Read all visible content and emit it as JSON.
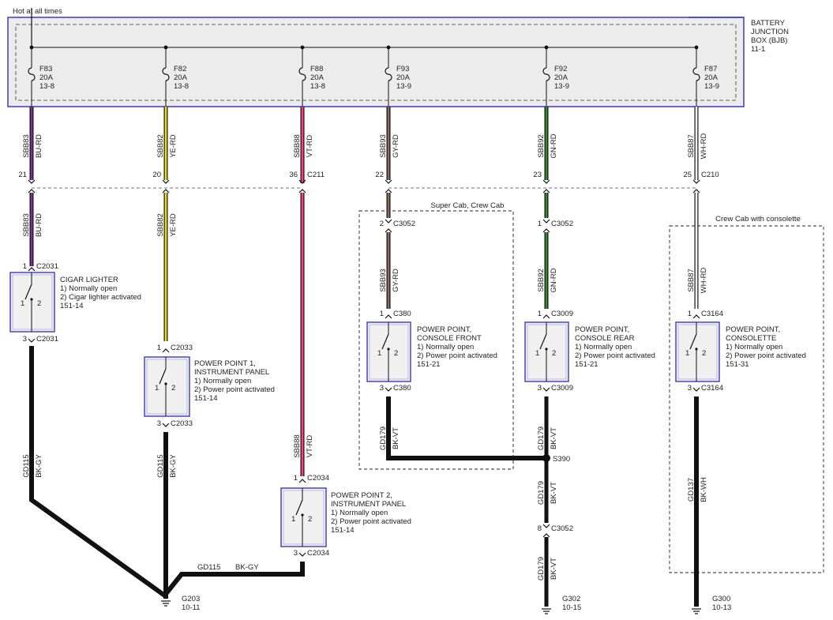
{
  "hot_label": "Hot at all times",
  "bjb": {
    "line1": "BATTERY",
    "line2": "JUNCTION",
    "line3": "BOX (BJB)",
    "ref": "11-1"
  },
  "colors": {
    "purple": "#7b3294",
    "yellow": "#f0e000",
    "pink": "#ff3d7f",
    "gray_brown": "#8c6a5c",
    "green": "#2e8b2e",
    "white": "#ffffff",
    "black": "#111111",
    "box_border": "#3a3ac8",
    "box_fill": "#f0f0f0",
    "bjb_fill": "#ececec"
  },
  "fuses": [
    {
      "name": "F83",
      "amps": "20A",
      "ref": "13-8"
    },
    {
      "name": "F82",
      "amps": "20A",
      "ref": "13-8"
    },
    {
      "name": "F88",
      "amps": "20A",
      "ref": "13-8"
    },
    {
      "name": "F93",
      "amps": "20A",
      "ref": "13-9"
    },
    {
      "name": "F92",
      "amps": "20A",
      "ref": "13-9"
    },
    {
      "name": "F87",
      "amps": "20A",
      "ref": "13-9"
    }
  ],
  "wires_top": [
    {
      "circuit": "SBB83",
      "color": "BU-RD"
    },
    {
      "circuit": "SBB82",
      "color": "YE-RD"
    },
    {
      "circuit": "SBB88",
      "color": "VT-RD"
    },
    {
      "circuit": "SBB93",
      "color": "GY-RD"
    },
    {
      "circuit": "SBB92",
      "color": "GN-RD"
    },
    {
      "circuit": "SBB87",
      "color": "WH-RD"
    }
  ],
  "bjb_connectors": [
    {
      "pin": "21",
      "name": ""
    },
    {
      "pin": "20",
      "name": ""
    },
    {
      "pin": "36",
      "name": "C211"
    },
    {
      "pin": "22",
      "name": ""
    },
    {
      "pin": "23",
      "name": ""
    },
    {
      "pin": "25",
      "name": "C210"
    }
  ],
  "options": {
    "super_crew": "Super Cab, Crew Cab",
    "crew_consolette": "Crew Cab with consolette"
  },
  "inline_connectors": {
    "c3052_gy": {
      "pin": "2",
      "name": "C3052"
    },
    "c3052_gn": {
      "pin": "1",
      "name": "C3052"
    },
    "c3052_bot": {
      "pin": "8",
      "name": "C3052"
    }
  },
  "wires_mid": [
    {
      "circuit": "SBB83",
      "color": "BU-RD"
    },
    {
      "circuit": "SBB82",
      "color": "YE-RD"
    },
    {
      "circuit": "SBB93",
      "color": "GY-RD"
    },
    {
      "circuit": "SBB92",
      "color": "GN-RD"
    },
    {
      "circuit": "SBB87",
      "color": "WH-RD"
    },
    {
      "circuit": "SBB88",
      "color": "VT-RD"
    }
  ],
  "components": [
    {
      "title1": "CIGAR LIGHTER",
      "title2": "",
      "desc1": "1) Normally open",
      "desc2": "2) Cigar lighter activated",
      "ref": "151-14",
      "in_pin": "1",
      "in_conn": "C2031",
      "out_pin": "3",
      "out_conn": "C2031",
      "p1": "1",
      "p2": "2"
    },
    {
      "title1": "POWER POINT 1,",
      "title2": "INSTRUMENT PANEL",
      "desc1": "1) Normally open",
      "desc2": "2) Power point activated",
      "ref": "151-14",
      "in_pin": "1",
      "in_conn": "C2033",
      "out_pin": "3",
      "out_conn": "C2033",
      "p1": "1",
      "p2": "2"
    },
    {
      "title1": "POWER POINT 2,",
      "title2": "INSTRUMENT PANEL",
      "desc1": "1) Normally open",
      "desc2": "2) Power point activated",
      "ref": "151-14",
      "in_pin": "1",
      "in_conn": "C2034",
      "out_pin": "3",
      "out_conn": "C2034",
      "p1": "1",
      "p2": "2"
    },
    {
      "title1": "POWER POINT,",
      "title2": "CONSOLE FRONT",
      "desc1": "1) Normally open",
      "desc2": "2) Power point activated",
      "ref": "151-21",
      "in_pin": "1",
      "in_conn": "C380",
      "out_pin": "3",
      "out_conn": "C380",
      "p1": "1",
      "p2": "2"
    },
    {
      "title1": "POWER POINT,",
      "title2": "CONSOLE REAR",
      "desc1": "1) Normally open",
      "desc2": "2) Power point activated",
      "ref": "151-21",
      "in_pin": "1",
      "in_conn": "C3009",
      "out_pin": "3",
      "out_conn": "C3009",
      "p1": "1",
      "p2": "2"
    },
    {
      "title1": "POWER POINT,",
      "title2": "CONSOLETTE",
      "desc1": "1) Normally open",
      "desc2": "2) Power point activated",
      "ref": "151-31",
      "in_pin": "1",
      "in_conn": "C3164",
      "out_pin": "3",
      "out_conn": "C3164",
      "p1": "1",
      "p2": "2"
    }
  ],
  "ground_wires": [
    {
      "circuit": "GD115",
      "color": "BK-GY"
    },
    {
      "circuit": "GD115",
      "color": "BK-GY"
    },
    {
      "circuit": "GD179",
      "color": "BK-VT"
    },
    {
      "circuit": "GD179",
      "color": "BK-VT"
    },
    {
      "circuit": "GD179",
      "color": "BK-VT"
    },
    {
      "circuit": "GD179",
      "color": "BK-VT"
    },
    {
      "circuit": "GD137",
      "color": "BK-WH"
    }
  ],
  "gd115_horizontal": {
    "circuit": "GD115",
    "color": "BK-GY"
  },
  "sbb88_lower": {
    "circuit": "SBB88",
    "color": "VT-RD"
  },
  "splice": "S390",
  "grounds": [
    {
      "name": "G203",
      "ref": "10-11"
    },
    {
      "name": "G302",
      "ref": "10-15"
    },
    {
      "name": "G300",
      "ref": "10-13"
    }
  ]
}
